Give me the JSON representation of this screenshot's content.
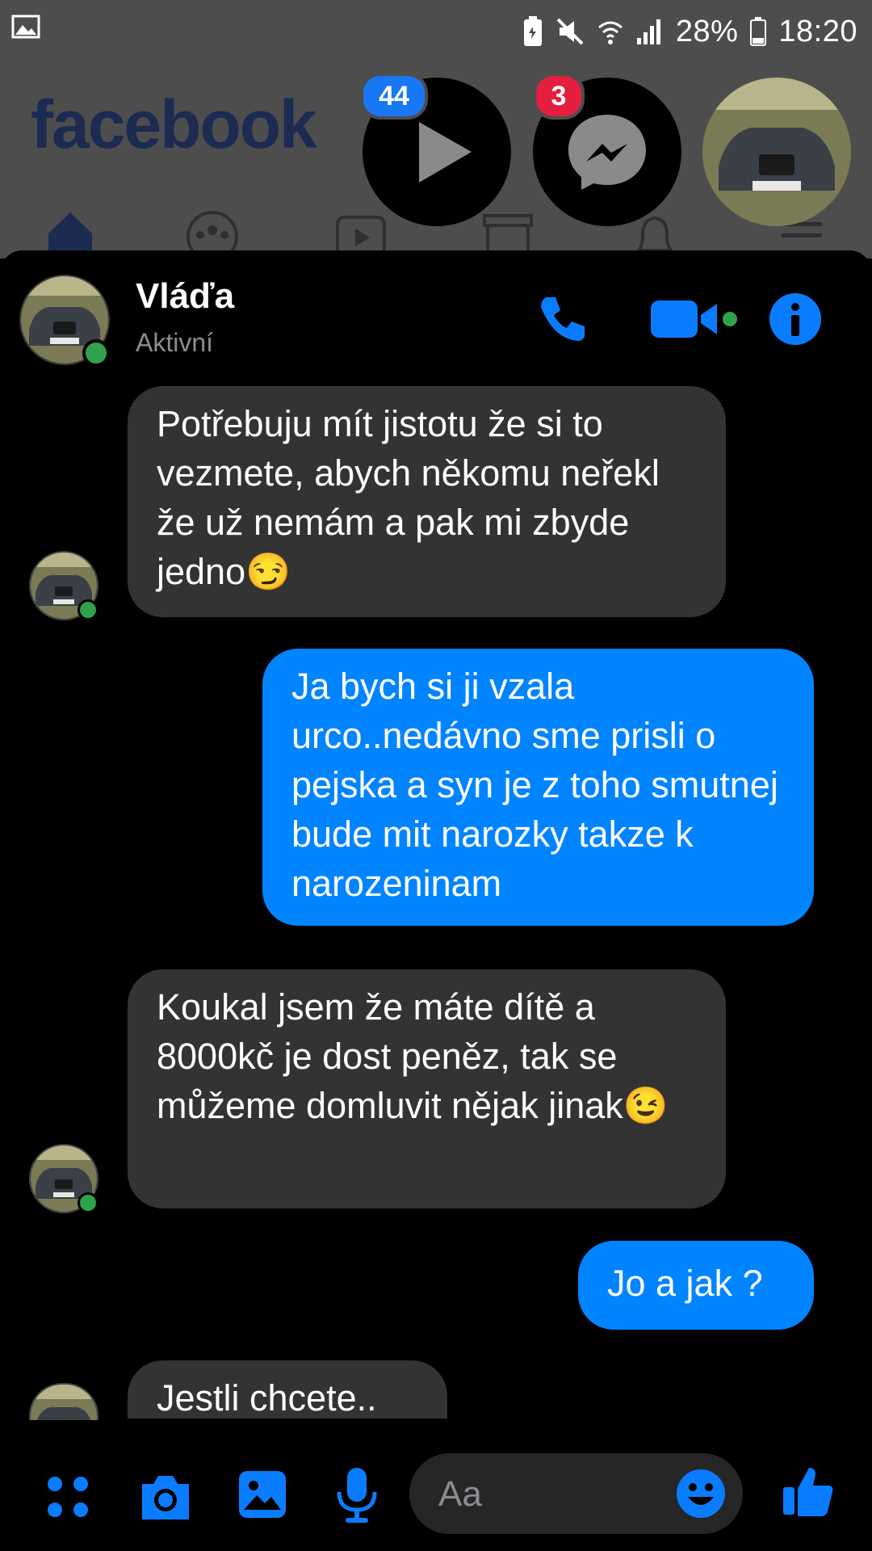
{
  "statusbar": {
    "battery": "28%",
    "time": "18:20",
    "icons": [
      "gallery-icon",
      "battery-saver-icon",
      "mute-icon",
      "wifi-icon",
      "signal-icon",
      "battery-icon"
    ]
  },
  "background_app": {
    "logo": "facebook",
    "nav_icons": [
      "home-icon",
      "groups-icon",
      "watch-icon",
      "marketplace-icon",
      "notifications-icon",
      "menu-icon"
    ]
  },
  "chat_heads": {
    "video_badge": "44",
    "messenger_badge": "3"
  },
  "chat": {
    "contact_name": "Vláďa",
    "contact_status": "Aktivní",
    "header_actions": [
      "phone-icon",
      "video-call-icon",
      "info-icon"
    ]
  },
  "messages": [
    {
      "from": "them",
      "text": "Potřebuju mít jistotu že si to vezmete, abych někomu neřekl že už nemám a pak mi zbyde jedno😏"
    },
    {
      "from": "me",
      "text": "Ja bych si ji vzala urco..nedávno sme prisli o pejska a syn je z toho smutnej bude mit narozky takze k narozeninam"
    },
    {
      "from": "them",
      "text": "Koukal jsem že máte dítě a 8000kč je dost peněz, tak se můžeme domluvit nějak jinak😉"
    },
    {
      "from": "me",
      "text": "Jo a jak ?"
    },
    {
      "from": "them",
      "text": "Jestli chcete.."
    }
  ],
  "composer": {
    "placeholder": "Aa",
    "icons": [
      "apps-icon",
      "camera-icon",
      "gallery-icon",
      "microphone-icon",
      "emoji-icon",
      "thumbs-up-icon"
    ]
  },
  "colors": {
    "outgoing_bubble": "#0084ff",
    "incoming_bubble": "#333333",
    "accent": "#1877f2",
    "online": "#31a24c"
  }
}
